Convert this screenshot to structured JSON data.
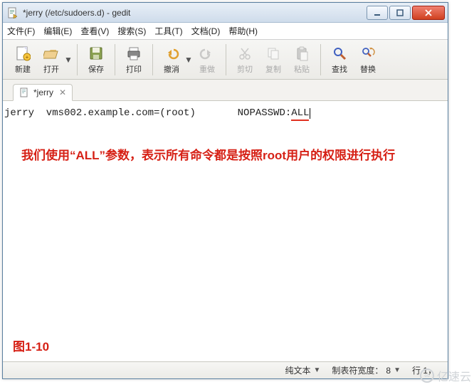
{
  "window": {
    "title": "*jerry (/etc/sudoers.d) - gedit"
  },
  "menus": {
    "file": "文件(F)",
    "edit": "编辑(E)",
    "view": "查看(V)",
    "search": "搜索(S)",
    "tools": "工具(T)",
    "documents": "文档(D)",
    "help": "帮助(H)"
  },
  "toolbar": {
    "new": "新建",
    "open": "打开",
    "save": "保存",
    "print": "打印",
    "undo": "撤消",
    "redo": "重做",
    "cut": "剪切",
    "copy": "复制",
    "paste": "粘贴",
    "find": "查找",
    "replace": "替换"
  },
  "tab": {
    "name": "*jerry"
  },
  "editor": {
    "line1_a": "jerry  vms002.example.com=(root)       NOPASSWD:",
    "line1_b": "ALL",
    "annotation": "我们使用“ALL”参数，表示所有命令都是按照root用户的权限进行执行",
    "figure_label": "图1-10"
  },
  "status": {
    "mode": "纯文本",
    "tabwidth_label": "制表符宽度：",
    "tabwidth_val": "8",
    "pos": "行 1，"
  },
  "watermark": "亿速云"
}
